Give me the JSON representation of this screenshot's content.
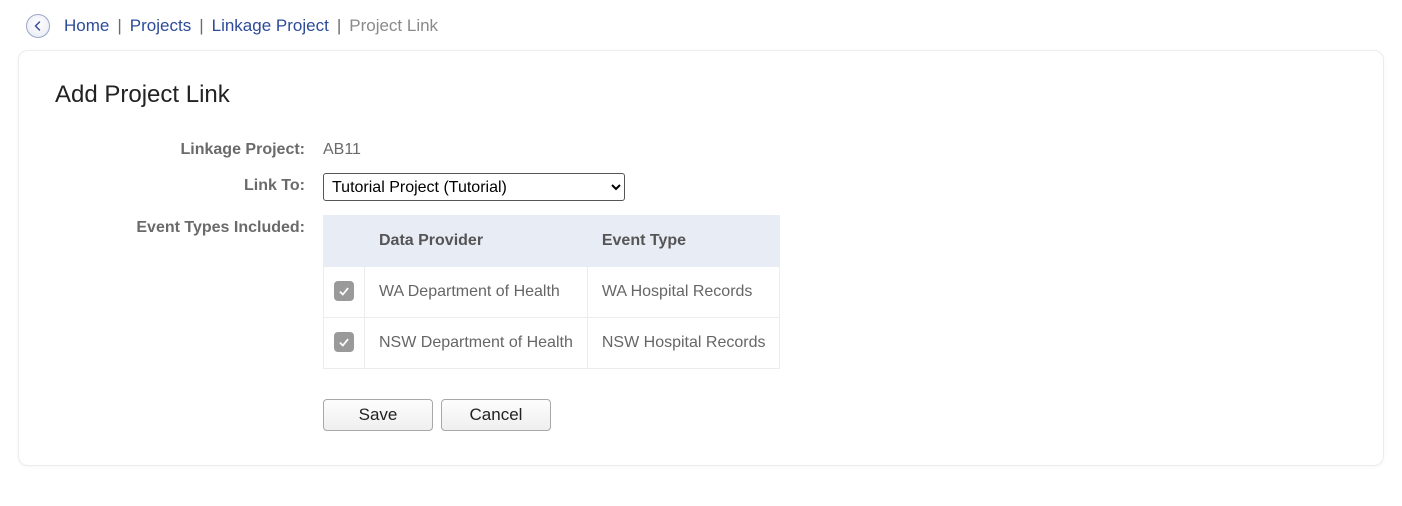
{
  "breadcrumb": {
    "items": [
      {
        "label": "Home"
      },
      {
        "label": "Projects"
      },
      {
        "label": "Linkage Project"
      }
    ],
    "current": "Project Link"
  },
  "panel": {
    "title": "Add Project Link"
  },
  "form": {
    "linkage_project_label": "Linkage Project:",
    "linkage_project_value": "AB11",
    "link_to_label": "Link To:",
    "link_to_selected": "Tutorial Project (Tutorial)",
    "event_types_label": "Event Types Included:"
  },
  "table": {
    "headers": {
      "data_provider": "Data Provider",
      "event_type": "Event Type"
    },
    "rows": [
      {
        "checked": true,
        "data_provider": "WA Department of Health",
        "event_type": "WA Hospital Records"
      },
      {
        "checked": true,
        "data_provider": "NSW Department of Health",
        "event_type": "NSW Hospital Records"
      }
    ]
  },
  "buttons": {
    "save": "Save",
    "cancel": "Cancel"
  }
}
